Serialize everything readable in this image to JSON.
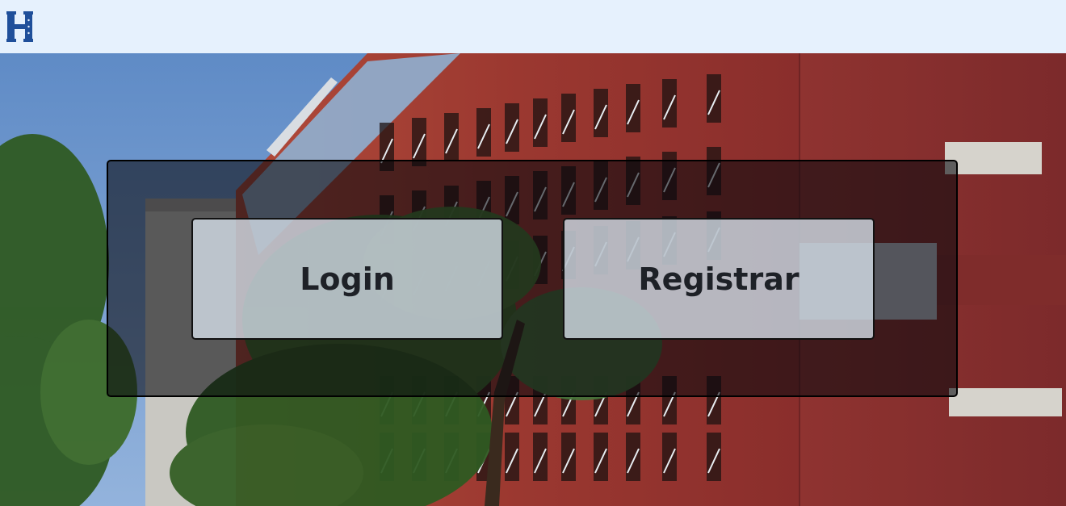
{
  "navbar": {
    "logo_letter": "H",
    "logo_color": "#1f4f9a",
    "background": "#e6f1fd"
  },
  "actions": {
    "login_label": "Login",
    "register_label": "Registrar"
  },
  "colors": {
    "panel_overlay": "rgba(8,8,14,0.58)",
    "button_fill": "rgba(212,222,233,0.80)",
    "button_text": "#1e2127",
    "building_red": "#9e3a30",
    "sky": "#6d98cf"
  }
}
